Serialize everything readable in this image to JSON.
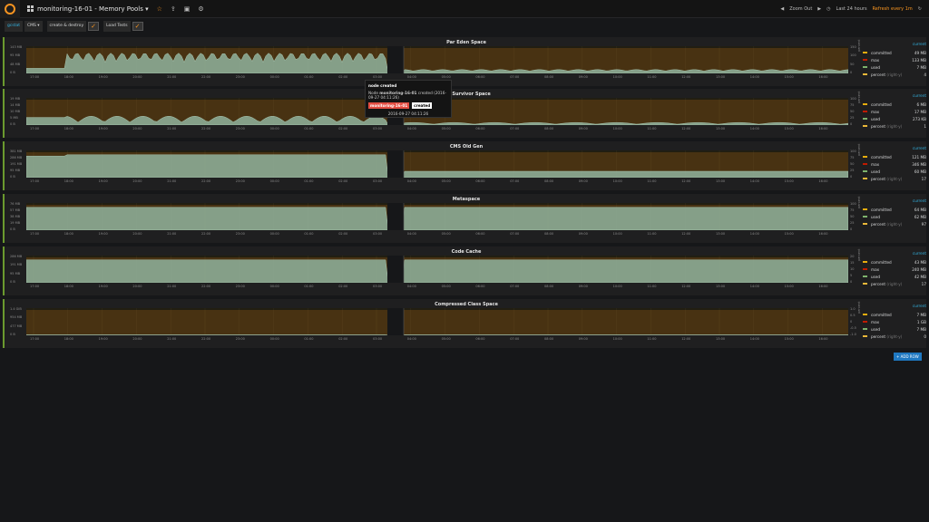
{
  "topbar": {
    "dashboard_title": "monitoring-16-01 - Memory Pools ▾",
    "zoom_out_label": "Zoom Out",
    "time_range_label": "Last 24 hours",
    "refresh_label": "Refresh every 1m"
  },
  "variables": {
    "gc_label": "gcstat",
    "gc_value": "CMS ▾",
    "create_destroy_label": "create & destroy",
    "load_tests_label": "Load Tests"
  },
  "x_ticks": [
    "17:00",
    "18:00",
    "19:00",
    "20:00",
    "21:00",
    "22:00",
    "23:00",
    "00:00",
    "01:00",
    "02:00",
    "03:00",
    "04:00",
    "05:00",
    "06:00",
    "07:00",
    "08:00",
    "09:00",
    "10:00",
    "11:00",
    "12:00",
    "13:00",
    "14:00",
    "15:00",
    "16:00"
  ],
  "panels": [
    {
      "title": "Par Eden Space",
      "y_left": [
        "143 MB",
        "95 MB",
        "48 MB",
        "0 B"
      ],
      "y_right": [
        "150",
        "100",
        "50",
        "0"
      ],
      "legend_header": "current",
      "legend": [
        {
          "name": "committed",
          "value": "49 MB",
          "color": "#e5ac0e"
        },
        {
          "name": "max",
          "value": "133 MB",
          "color": "#bf1b00"
        },
        {
          "name": "used",
          "value": "7 MB",
          "color": "#7eb26d"
        },
        {
          "name": "percent",
          "note": "(right-y)",
          "value": "4",
          "color": "#eab839"
        }
      ]
    },
    {
      "title": "Par Survivor Space",
      "y_left": [
        "19 MB",
        "14 MB",
        "10 MB",
        "5 MB",
        "0 B"
      ],
      "y_right": [
        "100",
        "75",
        "50",
        "25",
        "0"
      ],
      "legend_header": "current",
      "legend": [
        {
          "name": "committed",
          "value": "6 MB",
          "color": "#e5ac0e"
        },
        {
          "name": "max",
          "value": "17 MB",
          "color": "#bf1b00"
        },
        {
          "name": "used",
          "value": "273 KB",
          "color": "#7eb26d"
        },
        {
          "name": "percent",
          "note": "(right-y)",
          "value": "1",
          "color": "#eab839"
        }
      ]
    },
    {
      "title": "CMS Old Gen",
      "y_left": [
        "381 MB",
        "286 MB",
        "191 MB",
        "95 MB",
        "0 B"
      ],
      "y_right": [
        "100",
        "75",
        "50",
        "25",
        "0"
      ],
      "legend_header": "current",
      "legend": [
        {
          "name": "committed",
          "value": "121 MB",
          "color": "#e5ac0e"
        },
        {
          "name": "max",
          "value": "346 MB",
          "color": "#bf1b00"
        },
        {
          "name": "used",
          "value": "60 MB",
          "color": "#7eb26d"
        },
        {
          "name": "percent",
          "note": "(right-y)",
          "value": "17",
          "color": "#eab839"
        }
      ]
    },
    {
      "title": "Metaspace",
      "y_left": [
        "76 MB",
        "57 MB",
        "38 MB",
        "19 MB",
        "0 B"
      ],
      "y_right": [
        "100",
        "75",
        "50",
        "25",
        "0"
      ],
      "legend_header": "current",
      "legend": [
        {
          "name": "committed",
          "value": "64 MB",
          "color": "#e5ac0e"
        },
        {
          "name": "used",
          "value": "62 MB",
          "color": "#7eb26d"
        },
        {
          "name": "percent",
          "note": "(right-y)",
          "value": "97",
          "color": "#eab839"
        }
      ]
    },
    {
      "title": "Code Cache",
      "y_left": [
        "286 MB",
        "191 MB",
        "95 MB",
        "0 B"
      ],
      "y_right": [
        "20",
        "15",
        "10",
        "5",
        "0"
      ],
      "legend_header": "current",
      "legend": [
        {
          "name": "committed",
          "value": "43 MB",
          "color": "#e5ac0e"
        },
        {
          "name": "max",
          "value": "240 MB",
          "color": "#bf1b00"
        },
        {
          "name": "used",
          "value": "42 MB",
          "color": "#7eb26d"
        },
        {
          "name": "percent",
          "note": "(right-y)",
          "value": "17",
          "color": "#eab839"
        }
      ]
    },
    {
      "title": "Compressed Class Space",
      "y_left": [
        "1.4 GiB",
        "954 MB",
        "477 MB",
        "0 B"
      ],
      "y_right": [
        "1.0",
        "0.5",
        "0",
        "-0.5",
        "-1.0"
      ],
      "legend_header": "current",
      "legend": [
        {
          "name": "committed",
          "value": "7 MB",
          "color": "#e5ac0e"
        },
        {
          "name": "max",
          "value": "1 GB",
          "color": "#bf1b00"
        },
        {
          "name": "used",
          "value": "7 MB",
          "color": "#7eb26d"
        },
        {
          "name": "percent",
          "note": "(right-y)",
          "value": "0",
          "color": "#eab839"
        }
      ]
    }
  ],
  "right_axis_label": "percent",
  "tooltip": {
    "title": "node created",
    "body_prefix": "Node",
    "node": "monitoring-16-01",
    "body_suffix": "created (2016-09-27 04:11:26)",
    "tag1": "monitoring-16-01",
    "tag2": "created",
    "time": "2016-09-27 04:11:26"
  },
  "add_row_label": "+ ADD ROW",
  "colors": {
    "accent": "#f79420",
    "link": "#33b5e5",
    "fill": "#9ac4b0",
    "bg": "#161719"
  }
}
